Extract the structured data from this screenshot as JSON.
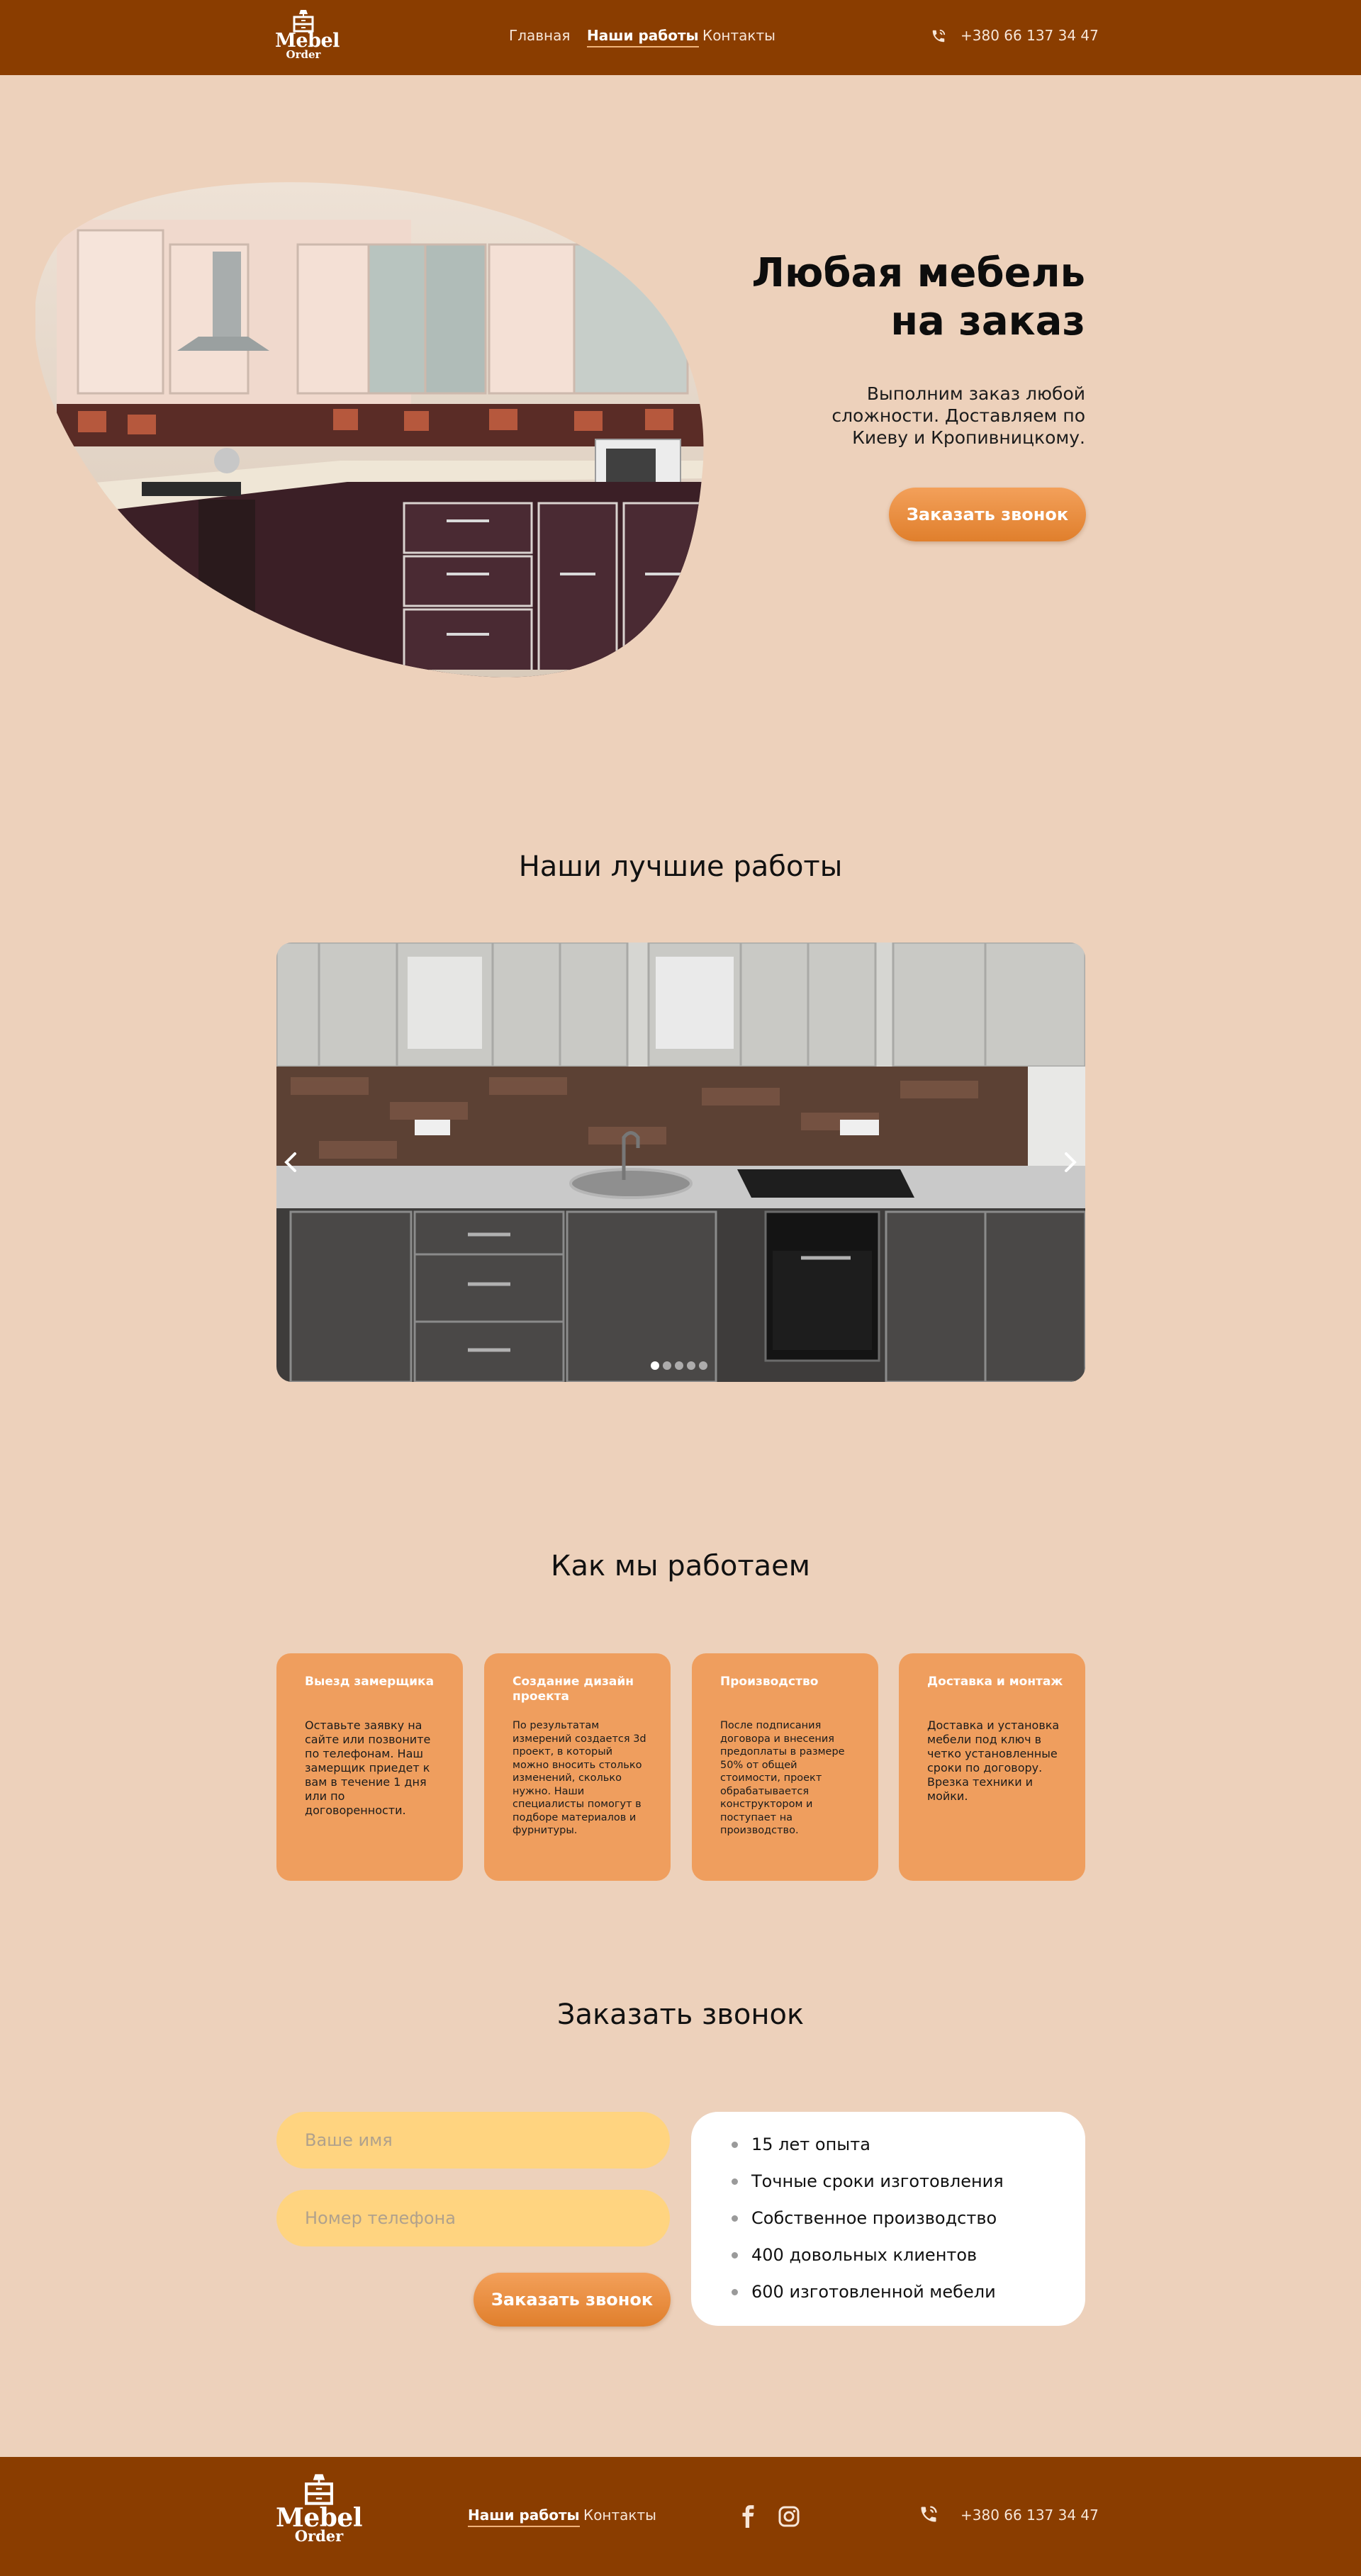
{
  "brand": {
    "line1": "Mebel",
    "line2": "Order"
  },
  "nav": {
    "items": [
      {
        "label": "Главная",
        "active": false
      },
      {
        "label": "Наши работы",
        "active": true
      },
      {
        "label": "Контакты",
        "active": false
      }
    ],
    "phone": "+380 66 137 34 47"
  },
  "hero": {
    "title_line1": "Любая мебель",
    "title_line2": "на заказ",
    "subtitle": "Выполним заказ любой сложности. Доставляем по Киеву и Кропивницкому.",
    "cta": "Заказать звонок"
  },
  "works": {
    "title": "Наши лучшие работы",
    "slides_count": 5,
    "active_slide": 1
  },
  "process": {
    "title": "Как мы работаем",
    "cards": [
      {
        "title": "Выезд замерщика",
        "text": "Оставьте заявку на сайте или позвоните по телефонам. Наш замерщик приедет к вам в течение 1 дня или по договоренности."
      },
      {
        "title": "Создание дизайн проекта",
        "text": "По результатам измерений создается 3d проект, в который можно вносить столько изменений, сколько нужно. Наши специалисты помогут в подборе материалов и фурнитуры."
      },
      {
        "title": "Производство",
        "text": "После подписания договора и внесения предоплаты в размере 50% от общей стоимости, проект обрабатывается конструктором и поступает на производство."
      },
      {
        "title": "Доставка и монтаж",
        "text": "Доставка и установка мебели под ключ в четко установленные сроки по договору. Врезка техники и мойки."
      }
    ]
  },
  "callback": {
    "title": "Заказать звонок",
    "name_placeholder": "Ваше имя",
    "phone_placeholder": "Номер телефона",
    "submit": "Заказать звонок",
    "benefits": [
      "15 лет опыта",
      "Точные сроки изготовления",
      "Собственное производство",
      "400 довольных клиентов",
      "600 изготовленной мебели"
    ]
  },
  "footer": {
    "links": [
      {
        "label": "Наши работы",
        "active": true
      },
      {
        "label": "Контакты",
        "active": false
      }
    ],
    "social": [
      "facebook-icon",
      "instagram-icon"
    ],
    "phone": "+380 66 137 34 47"
  },
  "colors": {
    "background": "#edd1bb",
    "header": "#8a3d00",
    "accent": "#e98d3f",
    "card": "#ef9e5e",
    "input": "#ffd480"
  }
}
